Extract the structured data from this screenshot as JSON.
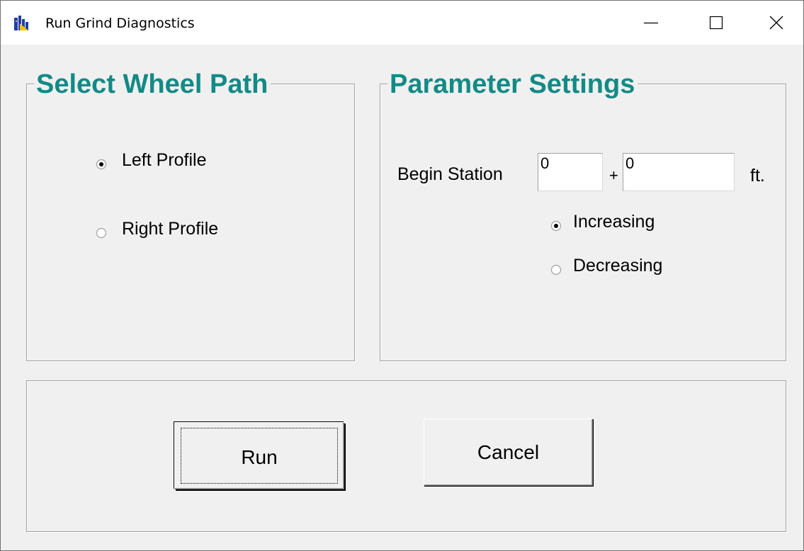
{
  "window": {
    "title": "Run Grind Diagnostics",
    "icon": "app-icon",
    "controls": {
      "minimize": "minimize-icon",
      "maximize": "maximize-icon",
      "close": "close-icon"
    }
  },
  "wheel_path": {
    "title": "Select Wheel Path",
    "options": [
      {
        "label": "Left Profile",
        "selected": true
      },
      {
        "label": "Right Profile",
        "selected": false
      }
    ]
  },
  "parameters": {
    "title": "Parameter Settings",
    "begin_station_label": "Begin Station",
    "station_value": "0",
    "plus_label": "+",
    "offset_value": "0",
    "unit_label": "ft.",
    "direction_options": [
      {
        "label": "Increasing",
        "selected": true
      },
      {
        "label": "Decreasing",
        "selected": false
      }
    ]
  },
  "actions": {
    "run_label": "Run",
    "cancel_label": "Cancel"
  },
  "colors": {
    "group_title": "#138a86",
    "dialog_bg": "#f0f0f0"
  }
}
